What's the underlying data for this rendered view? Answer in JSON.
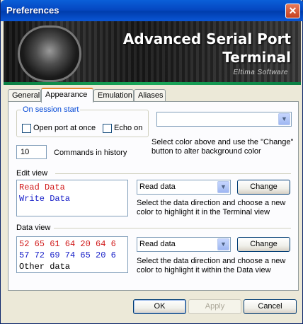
{
  "window": {
    "title": "Preferences",
    "close_glyph": "✕"
  },
  "banner": {
    "title": "Advanced Serial Port Terminal",
    "vendor": "Eltima Software"
  },
  "tabs": [
    {
      "label": "General",
      "active": false
    },
    {
      "label": "Appearance",
      "active": true
    },
    {
      "label": "Emulation",
      "active": false
    },
    {
      "label": "Aliases",
      "active": false
    }
  ],
  "session_start": {
    "legend": "On session start",
    "open_port": {
      "label": "Open port at once",
      "checked": false
    },
    "echo_on": {
      "label": "Echo on",
      "checked": false
    }
  },
  "background_color": {
    "value": "",
    "hint": "Select color above and use the \"Change\" button to alter background color"
  },
  "history": {
    "value": "10",
    "label": "Commands in history"
  },
  "edit_view": {
    "label": "Edit view",
    "preview_lines": [
      {
        "text": "Read Data",
        "color": "#d01818"
      },
      {
        "text": "Write Data",
        "color": "#1820c8"
      }
    ],
    "direction": "Read data",
    "change_label": "Change",
    "hint": "Select the data direction and choose a new color to highlight it in the Terminal view"
  },
  "data_view": {
    "label": "Data view",
    "preview_lines": [
      {
        "text": "52 65 61 64 20 64 6",
        "color": "#d01818"
      },
      {
        "text": "57 72 69 74 65 20 6",
        "color": "#1820c8"
      },
      {
        "text": "Other data",
        "color": "#000000"
      }
    ],
    "direction": "Read data",
    "change_label": "Change",
    "hint": "Select the data direction and choose a new color to highlight it within the Data view"
  },
  "footer": {
    "ok_label": "OK",
    "apply_label": "Apply",
    "cancel_label": "Cancel"
  },
  "icons": {
    "close": "close-icon",
    "dropdown": "chevron-down-icon"
  }
}
